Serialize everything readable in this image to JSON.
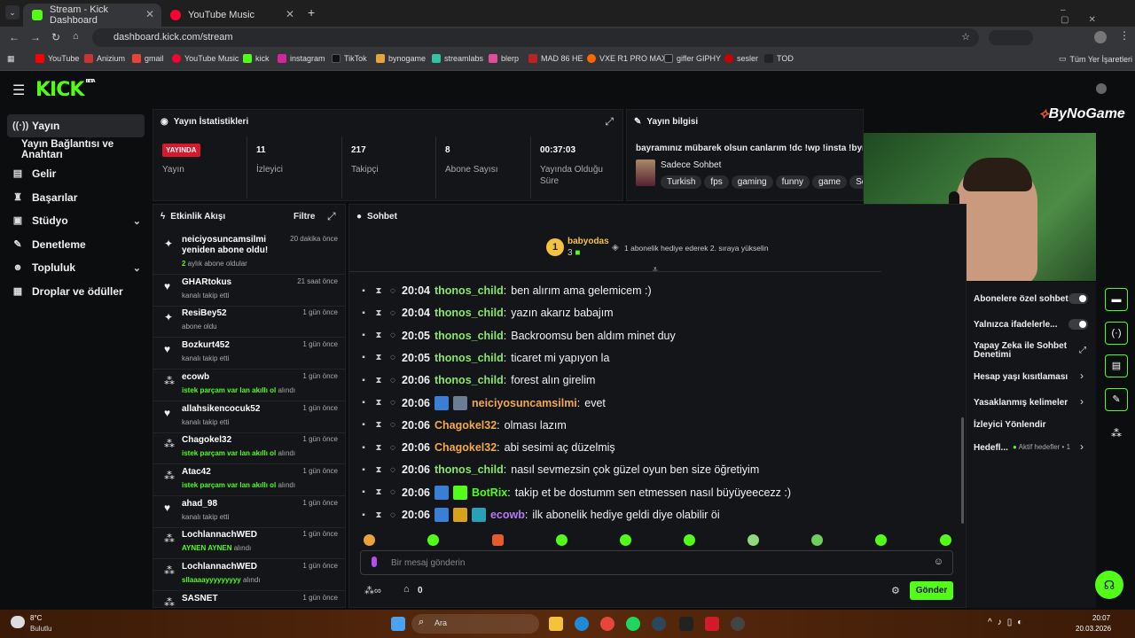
{
  "browser": {
    "tabs": [
      {
        "label": "Stream - Kick Dashboard",
        "active": true
      },
      {
        "label": "YouTube Music",
        "active": false
      }
    ],
    "url": "dashboard.kick.com/stream",
    "bookmarks": [
      "YouTube",
      "Anizium",
      "gmail",
      "YouTube Music",
      "kick",
      "instagram",
      "TikTok",
      "bynogame",
      "streamlabs",
      "blerp",
      "MAD 86 HE",
      "VXE R1 PRO MAX",
      "gifler GIPHY",
      "sesler",
      "TOD"
    ],
    "bookmarks_all": "Tüm Yer İşaretleri"
  },
  "header": {
    "logo": "KICK",
    "beta": "BETA"
  },
  "sidebar": {
    "items": [
      {
        "label": "Yayın",
        "icon": "broadcast-icon"
      },
      {
        "label": "Yayın Bağlantısı ve Anahtarı",
        "icon": ""
      },
      {
        "label": "Gelir",
        "icon": "revenue-icon"
      },
      {
        "label": "Başarılar",
        "icon": "trophy-icon"
      },
      {
        "label": "Stüdyo",
        "icon": "studio-icon"
      },
      {
        "label": "Denetleme",
        "icon": "wrench-icon"
      },
      {
        "label": "Topluluk",
        "icon": "people-icon"
      },
      {
        "label": "Droplar ve ödüller",
        "icon": "gift-icon"
      }
    ]
  },
  "stats": {
    "title": "Yayın İstatistikleri",
    "live_badge": "YAYINDA",
    "live_label": "Yayın",
    "items": [
      {
        "value": "11",
        "label": "İzleyici"
      },
      {
        "value": "217",
        "label": "Takipçi"
      },
      {
        "value": "8",
        "label": "Abone Sayısı"
      },
      {
        "value": "00:37:03",
        "label": "Yayında Olduğu Süre"
      }
    ]
  },
  "info": {
    "title": "Yayın bilgisi",
    "stream_title": "bayramınız mübarek olsun canlarım !dc !wp !insta !bynog",
    "category": "Sadece Sohbet",
    "tags": [
      "Turkish",
      "fps",
      "gaming",
      "funny",
      "game",
      "Soh"
    ],
    "overlay_logo": "ByNoGame"
  },
  "activity": {
    "title": "Etkinlik Akışı",
    "filter": "Filtre",
    "events": [
      {
        "name": "neiciyosuncamsilmi yeniden abone oldu!",
        "time": "20 dakika önce",
        "sub_hl": "2",
        "sub": " aylık abone oldular",
        "icon": "star-icon"
      },
      {
        "name": "GHARtokus",
        "time": "21 saat önce",
        "sub_hl": "",
        "sub": "kanalı takip etti",
        "icon": "heart-icon"
      },
      {
        "name": "ResiBey52",
        "time": "1 gün önce",
        "sub_hl": "",
        "sub": "abone oldu",
        "icon": "star-icon"
      },
      {
        "name": "Bozkurt452",
        "time": "1 gün önce",
        "sub_hl": "",
        "sub": "kanalı takip etti",
        "icon": "heart-icon"
      },
      {
        "name": "ecowb",
        "time": "1 gün önce",
        "sub_hl": "istek parçam var lan akıllı ol",
        "sub": " alındı",
        "icon": "dots-icon"
      },
      {
        "name": "allahsikencocuk52",
        "time": "1 gün önce",
        "sub_hl": "",
        "sub": "kanalı takip etti",
        "icon": "heart-icon"
      },
      {
        "name": "Chagokel32",
        "time": "1 gün önce",
        "sub_hl": "istek parçam var lan akıllı ol",
        "sub": " alındı",
        "icon": "dots-icon"
      },
      {
        "name": "Atac42",
        "time": "1 gün önce",
        "sub_hl": "istek parçam var lan akıllı ol",
        "sub": " alındı",
        "icon": "dots-icon"
      },
      {
        "name": "ahad_98",
        "time": "1 gün önce",
        "sub_hl": "",
        "sub": "kanalı takip etti",
        "icon": "heart-icon"
      },
      {
        "name": "LochlannachWED",
        "time": "1 gün önce",
        "sub_hl": "AYNEN AYNEN",
        "sub": " alındı",
        "icon": "dots-icon"
      },
      {
        "name": "LochlannachWED",
        "time": "1 gün önce",
        "sub_hl": "sllaaaayyyyyyyyy",
        "sub": " alındı",
        "icon": "dots-icon"
      },
      {
        "name": "SASNET",
        "time": "1 gün önce",
        "sub_hl": "",
        "sub": "",
        "icon": "dots-icon"
      }
    ]
  },
  "chat": {
    "title": "Sohbet",
    "pinned_user": "babyodas",
    "pinned_rank": "1",
    "pinned_count": "3",
    "pinned_text": "1 abonelik hediye ederek 2. sıraya yükselin",
    "messages": [
      {
        "time": "20:04",
        "user": "thonos_child",
        "color": "#8ae66b",
        "text": "ben alırım ama gelemicem :)",
        "badges": 0
      },
      {
        "time": "20:04",
        "user": "thonos_child",
        "color": "#8ae66b",
        "text": "yazın akarız babajım",
        "badges": 0
      },
      {
        "time": "20:05",
        "user": "thonos_child",
        "color": "#8ae66b",
        "text": "Backroomsu ben aldım minet duy",
        "badges": 0
      },
      {
        "time": "20:05",
        "user": "thonos_child",
        "color": "#8ae66b",
        "text": "ticaret mi yapıyon la",
        "badges": 0
      },
      {
        "time": "20:06",
        "user": "thonos_child",
        "color": "#8ae66b",
        "text": "forest alın girelim",
        "badges": 0
      },
      {
        "time": "20:06",
        "user": "neiciyosuncamsilmi",
        "color": "#f2a94e",
        "text": "evet",
        "badges": 2
      },
      {
        "time": "20:06",
        "user": "Chagokel32",
        "color": "#f2a94e",
        "text": "olması lazım",
        "badges": 0
      },
      {
        "time": "20:06",
        "user": "Chagokel32",
        "color": "#f2a94e",
        "text": "abi sesimi aç düzelmiş",
        "badges": 0
      },
      {
        "time": "20:06",
        "user": "thonos_child",
        "color": "#8ae66b",
        "text": "nasıl sevmezsin çok güzel oyun ben size öğretiyim",
        "badges": 0
      },
      {
        "time": "20:06",
        "user": "BotRix",
        "color": "#53fc18",
        "text": "takip et be dostumm sen etmessen nasıl büyüyeecezz :)",
        "badges": 2
      },
      {
        "time": "20:06",
        "user": "ecowb",
        "color": "#b57cf2",
        "text": "ilk abonelik hediye geldi diye olabilir öi",
        "badges": 3
      }
    ],
    "input_placeholder": "Bir mesaj gönderin",
    "count": "0",
    "send": "Gönder"
  },
  "chat_settings": {
    "sub_only": "Abonelere özel sohbet",
    "emote_only": "Yalnızca ifadelerle...",
    "ai_mod": "Yapay Zeka ile Sohbet Denetimi",
    "age": "Hesap yaşı kısıtlaması",
    "banned": "Yasaklanmış kelimeler",
    "redirect": "İzleyici Yönlendir",
    "goals": "Hedefl...",
    "goals_status": "Aktif hedefler",
    "goals_count": "1"
  },
  "taskbar": {
    "temp": "8°C",
    "weather": "Bulutlu",
    "search": "Ara",
    "time": "20:07",
    "date": "20.03.2026"
  }
}
